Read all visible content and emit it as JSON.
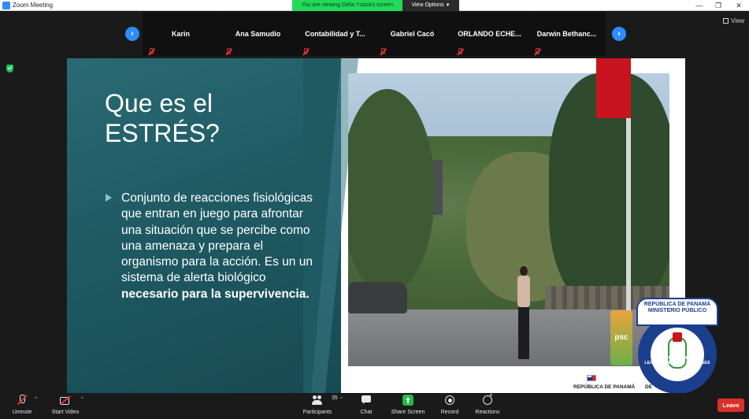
{
  "window": {
    "title": "Zoom Meeting"
  },
  "banner": {
    "viewing": "You are viewing Delia Ycaza's screen",
    "view_options": "View Options"
  },
  "top_right": {
    "view_label": "View"
  },
  "participants": [
    {
      "name": "Karin"
    },
    {
      "name": "Ana Samudio"
    },
    {
      "name": "Contabilidad  y  T..."
    },
    {
      "name": "Gabriel Cacó"
    },
    {
      "name": "ORLANDO  ECHE..."
    },
    {
      "name": "Darwin  Bethanc..."
    }
  ],
  "slide": {
    "title_line1": "Que es el",
    "title_line2": "ESTRÉS?",
    "body_text": "Conjunto de reacciones fisiológicas que entran en juego para afrontar una situación que se percibe como una amenaza y prepara el organismo para la acción. Es un un sistema de alerta biológico ",
    "body_bold": "necesario para la supervivencia.",
    "logo_text": "psc",
    "footer_republica": "REPÚBLICA DE PANAMÁ",
    "footer_de": "DE",
    "seal_line1": "REPÚBLICA DE PANAMÁ",
    "seal_line2": "MINISTERIO PÚBLICO",
    "seal_ring": "INSTITUTO DE MEDICINA LEGAL Y CIENCIAS FORENSES"
  },
  "toolbar": {
    "unmute": "Unmute",
    "start_video": "Start Video",
    "participants": "Participants",
    "participants_count": "35",
    "chat": "Chat",
    "share_screen": "Share Screen",
    "record": "Record",
    "reactions": "Reactions",
    "leave": "Leave"
  },
  "colors": {
    "accent": "#2d8cff",
    "share_green": "#23b84a",
    "leave_red": "#d9302b",
    "slide_teal": "#1f5a63",
    "banner_green": "#23d959"
  }
}
